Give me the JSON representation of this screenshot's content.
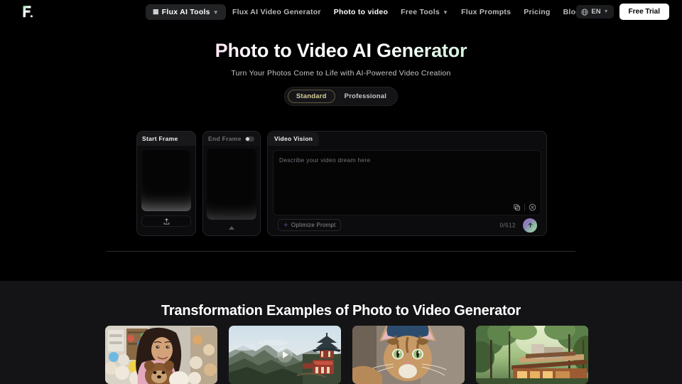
{
  "navbar": {
    "logo_text": "F.",
    "items": [
      {
        "label": "Flux AI Tools",
        "style": "pill",
        "has_chevron": true,
        "lead_icon": "grid-icon"
      },
      {
        "label": "Flux AI Video Generator",
        "style": "plain",
        "has_chevron": false
      },
      {
        "label": "Photo to video",
        "style": "active",
        "has_chevron": false
      },
      {
        "label": "Free Tools",
        "style": "plain",
        "has_chevron": true
      },
      {
        "label": "Flux Prompts",
        "style": "plain",
        "has_chevron": false
      },
      {
        "label": "Pricing",
        "style": "plain",
        "has_chevron": false
      },
      {
        "label": "Blog",
        "style": "plain",
        "has_chevron": false
      }
    ],
    "language": {
      "label": "EN",
      "icon": "globe-icon"
    },
    "cta": "Free Trial"
  },
  "hero": {
    "title": "Photo to Video AI Generator",
    "subtitle": "Turn Your Photos Come to Life with AI-Powered Video Creation",
    "gradient_start": "#f4a0d8",
    "gradient_mid": "#ffffff",
    "gradient_end": "#93e3ae"
  },
  "mode_toggle": {
    "selected": "Standard",
    "options": [
      "Standard",
      "Professional"
    ],
    "selected_color": "#d9cf9a"
  },
  "composer": {
    "start_frame": {
      "title": "Start Frame",
      "upload_icon": "upload-icon"
    },
    "end_frame": {
      "title": "End Frame",
      "toggle_on": false
    },
    "vision": {
      "tab_label": "Video Vision",
      "placeholder": "Describe your video dream here",
      "value": "",
      "copy_icon": "copy-icon",
      "clear_icon": "clear-circle-icon",
      "optimize_label": "Optimize Prompt",
      "optimize_icon": "sparkle-icon",
      "counter": "0/512",
      "send_icon": "arrow-up-icon"
    }
  },
  "examples": {
    "heading": "Transformation Examples of Photo to Video Generator",
    "cards": [
      {
        "alt": "Girl holding a teddy bear in a colorful toy room",
        "has_play": false
      },
      {
        "alt": "Mountain landscape with a pagoda temple on a cliff",
        "has_play": true
      },
      {
        "alt": "Close-up of a tabby cat wearing a blue cap",
        "has_play": false
      },
      {
        "alt": "Modern house in a green forest",
        "has_play": false
      }
    ]
  }
}
